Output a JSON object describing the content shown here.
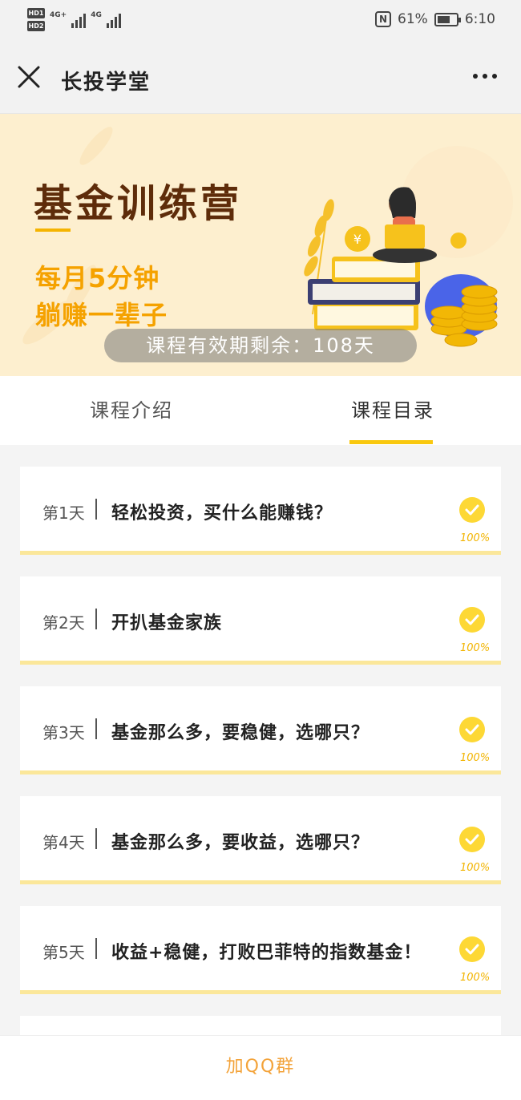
{
  "status_bar": {
    "sim1": "HD1",
    "sim2": "HD2",
    "network1": "4G+",
    "network2": "4G",
    "battery_percent": "61%",
    "time": "6:10",
    "nfc_letter": "N"
  },
  "nav": {
    "title": "长投学堂"
  },
  "banner": {
    "title": "基金训练营",
    "slogan_line1": "每月5分钟",
    "slogan_line2": "躺赚一辈子",
    "validity_text": "课程有效期剩余：108天"
  },
  "tabs": {
    "intro": "课程介绍",
    "catalog": "课程目录",
    "active": "catalog"
  },
  "lessons": [
    {
      "day": "第1天",
      "title": "轻松投资，买什么能赚钱？",
      "progress": "100%"
    },
    {
      "day": "第2天",
      "title": "开扒基金家族",
      "progress": "100%"
    },
    {
      "day": "第3天",
      "title": "基金那么多，要稳健，选哪只？",
      "progress": "100%"
    },
    {
      "day": "第4天",
      "title": "基金那么多，要收益，选哪只？",
      "progress": "100%"
    },
    {
      "day": "第5天",
      "title": "收益+稳健，打败巴菲特的指数基金！",
      "progress": "100%"
    }
  ],
  "bottom_action": {
    "label": "加QQ群"
  },
  "colors": {
    "accent_yellow": "#f9c80e",
    "banner_bg": "#fdefcf",
    "title_brown": "#5e2c0a",
    "slogan_orange": "#f5a200",
    "action_orange": "#f3a33a"
  }
}
